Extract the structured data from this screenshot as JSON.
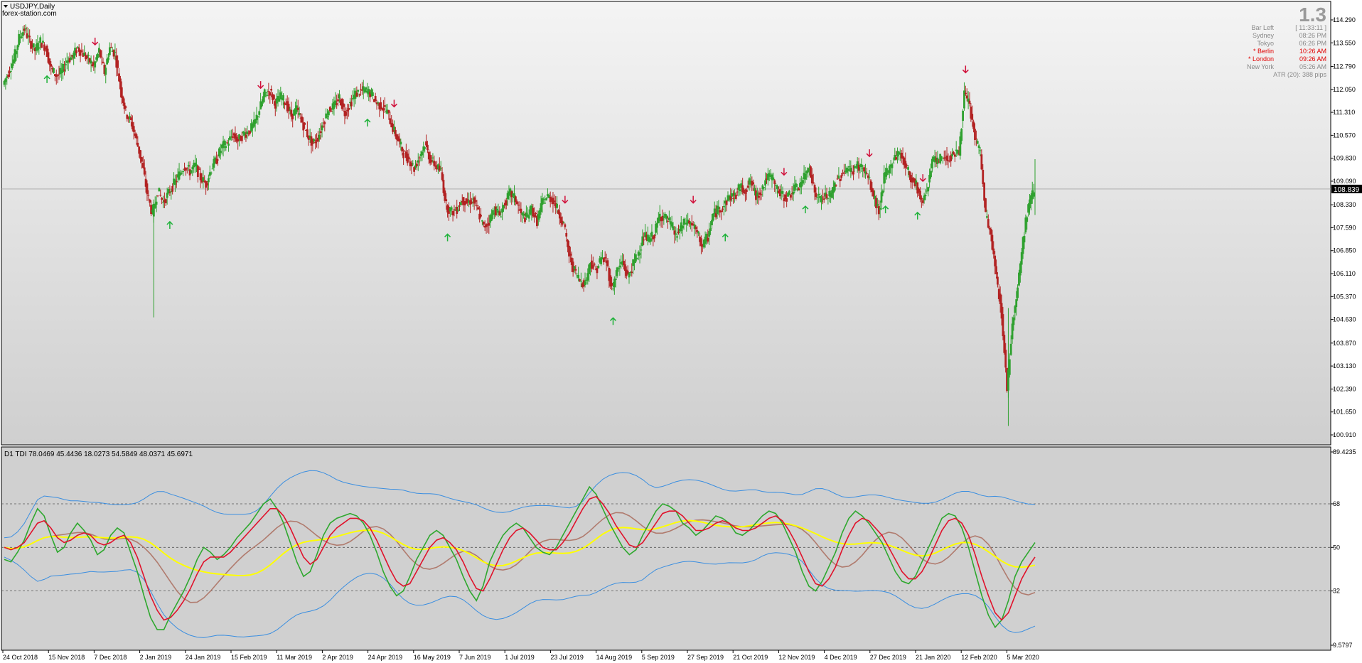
{
  "main_panel": {
    "symbol_label": "USDJPY,Daily",
    "watermark": "forex-station.com",
    "current_price_label": "108.839",
    "current_price": 108.839,
    "y_ticks": [
      "114.290",
      "113.550",
      "112.790",
      "112.050",
      "111.310",
      "110.570",
      "109.830",
      "109.090",
      "108.330",
      "107.590",
      "106.850",
      "106.110",
      "105.370",
      "104.630",
      "103.870",
      "103.130",
      "102.390",
      "101.650",
      "100.910"
    ],
    "colors": {
      "bull": "#2fa12f",
      "bear": "#b22222",
      "arrow_up": "#1fb23a",
      "arrow_down": "#d0103a",
      "gridline": "#a8a8a8"
    }
  },
  "info_panel": {
    "big_value": "1.3",
    "rows": [
      {
        "label": "Bar Left",
        "value": "[ 11:33:11 ]",
        "highlight": false
      },
      {
        "label": "Sydney",
        "value": "08:26 PM",
        "highlight": false
      },
      {
        "label": "Tokyo",
        "value": "06:26 PM",
        "highlight": false
      },
      {
        "label": "* Berlin",
        "value": "10:26 AM",
        "highlight": true
      },
      {
        "label": "* London",
        "value": "09:26 AM",
        "highlight": true
      },
      {
        "label": "New York",
        "value": "05:26 AM",
        "highlight": false
      },
      {
        "label": "ATR (20): 388 pips",
        "value": "",
        "highlight": false
      }
    ]
  },
  "indicator_panel": {
    "label": "D1 TDI 78.0469 45.4436 18.0273 54.5849 48.0371 45.6971",
    "y_ticks": [
      "89.4235",
      "68",
      "50",
      "32",
      "9.5797"
    ],
    "colors": {
      "upper_band": "#3a8ee0",
      "green": "#2ea82e",
      "red": "#e0122b",
      "yellow": "#ffff00",
      "brown": "#b07b6e"
    }
  },
  "x_axis": {
    "labels": [
      "24 Oct 2018",
      "15 Nov 2018",
      "7 Dec 2018",
      "2 Jan 2019",
      "24 Jan 2019",
      "15 Feb 2019",
      "11 Mar 2019",
      "2 Apr 2019",
      "24 Apr 2019",
      "16 May 2019",
      "7 Jun 2019",
      "1 Jul 2019",
      "23 Jul 2019",
      "14 Aug 2019",
      "5 Sep 2019",
      "27 Sep 2019",
      "21 Oct 2019",
      "12 Nov 2019",
      "4 Dec 2019",
      "27 Dec 2019",
      "21 Jan 2020",
      "12 Feb 2020",
      "5 Mar 2020"
    ]
  },
  "chart_data": [
    {
      "type": "candlestick",
      "title": "USDJPY,Daily",
      "ylim": [
        100.91,
        114.29
      ],
      "price_path": [
        [
          0,
          112.2
        ],
        [
          1,
          112.6
        ],
        [
          2,
          113.0
        ],
        [
          3,
          113.7
        ],
        [
          4,
          114.0
        ],
        [
          5,
          113.6
        ],
        [
          6,
          113.3
        ],
        [
          7,
          113.6
        ],
        [
          8,
          113.4
        ],
        [
          9,
          112.7
        ],
        [
          10,
          112.5
        ],
        [
          11,
          112.6
        ],
        [
          12,
          113.0
        ],
        [
          13,
          113.1
        ],
        [
          14,
          113.4
        ],
        [
          15,
          113.2
        ],
        [
          16,
          113.0
        ],
        [
          17,
          112.8
        ],
        [
          18,
          113.3
        ],
        [
          19,
          112.6
        ],
        [
          20,
          113.4
        ],
        [
          21,
          113.2
        ],
        [
          22,
          112.1
        ],
        [
          23,
          111.3
        ],
        [
          24,
          111.0
        ],
        [
          25,
          110.4
        ],
        [
          26,
          109.7
        ],
        [
          27,
          108.7
        ],
        [
          28,
          108.0
        ],
        [
          29,
          108.8
        ],
        [
          30,
          108.4
        ],
        [
          31,
          108.7
        ],
        [
          32,
          109.0
        ],
        [
          33,
          109.3
        ],
        [
          34,
          109.6
        ],
        [
          35,
          109.4
        ],
        [
          36,
          109.6
        ],
        [
          37,
          109.2
        ],
        [
          38,
          109.0
        ],
        [
          39,
          109.5
        ],
        [
          40,
          109.8
        ],
        [
          41,
          110.2
        ],
        [
          42,
          110.3
        ],
        [
          43,
          110.6
        ],
        [
          44,
          110.4
        ],
        [
          45,
          110.6
        ],
        [
          46,
          110.7
        ],
        [
          47,
          110.9
        ],
        [
          48,
          111.4
        ],
        [
          49,
          111.9
        ],
        [
          50,
          112.0
        ],
        [
          51,
          111.6
        ],
        [
          52,
          111.8
        ],
        [
          53,
          111.6
        ],
        [
          54,
          111.2
        ],
        [
          55,
          111.4
        ],
        [
          56,
          111.0
        ],
        [
          57,
          110.6
        ],
        [
          58,
          110.3
        ],
        [
          59,
          110.5
        ],
        [
          60,
          111.0
        ],
        [
          61,
          111.4
        ],
        [
          62,
          111.5
        ],
        [
          63,
          111.8
        ],
        [
          64,
          111.3
        ],
        [
          65,
          111.6
        ],
        [
          66,
          111.9
        ],
        [
          67,
          112.0
        ],
        [
          68,
          112.0
        ],
        [
          69,
          111.9
        ],
        [
          70,
          111.6
        ],
        [
          71,
          111.5
        ],
        [
          72,
          111.3
        ],
        [
          73,
          110.8
        ],
        [
          74,
          110.4
        ],
        [
          75,
          110.0
        ],
        [
          76,
          109.8
        ],
        [
          77,
          109.5
        ],
        [
          78,
          109.9
        ],
        [
          79,
          110.3
        ],
        [
          80,
          109.8
        ],
        [
          81,
          109.6
        ],
        [
          82,
          109.4
        ],
        [
          83,
          108.3
        ],
        [
          84,
          108.1
        ],
        [
          85,
          108.2
        ],
        [
          86,
          108.5
        ],
        [
          87,
          108.4
        ],
        [
          88,
          108.5
        ],
        [
          89,
          108.1
        ],
        [
          90,
          107.6
        ],
        [
          91,
          107.8
        ],
        [
          92,
          108.2
        ],
        [
          93,
          108.0
        ],
        [
          94,
          108.4
        ],
        [
          95,
          108.7
        ],
        [
          96,
          108.5
        ],
        [
          97,
          108.0
        ],
        [
          98,
          107.9
        ],
        [
          99,
          108.2
        ],
        [
          100,
          107.8
        ],
        [
          101,
          108.4
        ],
        [
          102,
          108.6
        ],
        [
          103,
          108.5
        ],
        [
          104,
          108.1
        ],
        [
          105,
          107.7
        ],
        [
          106,
          106.7
        ],
        [
          107,
          106.2
        ],
        [
          108,
          105.9
        ],
        [
          109,
          105.8
        ],
        [
          110,
          106.5
        ],
        [
          111,
          106.2
        ],
        [
          112,
          106.6
        ],
        [
          113,
          106.5
        ],
        [
          114,
          105.6
        ],
        [
          115,
          106.2
        ],
        [
          116,
          106.5
        ],
        [
          117,
          106.0
        ],
        [
          118,
          106.4
        ],
        [
          119,
          106.8
        ],
        [
          120,
          107.3
        ],
        [
          121,
          107.2
        ],
        [
          122,
          107.4
        ],
        [
          123,
          108.0
        ],
        [
          124,
          107.9
        ],
        [
          125,
          107.7
        ],
        [
          126,
          107.3
        ],
        [
          127,
          107.6
        ],
        [
          128,
          107.8
        ],
        [
          129,
          107.7
        ],
        [
          130,
          107.4
        ],
        [
          131,
          107.0
        ],
        [
          132,
          107.3
        ],
        [
          133,
          108.0
        ],
        [
          134,
          108.2
        ],
        [
          135,
          108.3
        ],
        [
          136,
          108.6
        ],
        [
          137,
          108.6
        ],
        [
          138,
          108.9
        ],
        [
          139,
          108.8
        ],
        [
          140,
          109.1
        ],
        [
          141,
          108.6
        ],
        [
          142,
          108.8
        ],
        [
          143,
          109.2
        ],
        [
          144,
          109.2
        ],
        [
          145,
          108.8
        ],
        [
          146,
          108.6
        ],
        [
          147,
          108.6
        ],
        [
          148,
          108.8
        ],
        [
          149,
          108.9
        ],
        [
          150,
          109.2
        ],
        [
          151,
          109.6
        ],
        [
          152,
          108.7
        ],
        [
          153,
          108.5
        ],
        [
          154,
          108.6
        ],
        [
          155,
          108.6
        ],
        [
          156,
          109.1
        ],
        [
          157,
          109.3
        ],
        [
          158,
          109.5
        ],
        [
          159,
          109.4
        ],
        [
          160,
          109.6
        ],
        [
          161,
          109.5
        ],
        [
          162,
          109.2
        ],
        [
          163,
          108.6
        ],
        [
          164,
          108.1
        ],
        [
          165,
          109.2
        ],
        [
          166,
          109.5
        ],
        [
          167,
          109.9
        ],
        [
          168,
          110.0
        ],
        [
          169,
          109.6
        ],
        [
          170,
          109.2
        ],
        [
          171,
          109.0
        ],
        [
          172,
          108.4
        ],
        [
          173,
          108.8
        ],
        [
          174,
          109.8
        ],
        [
          175,
          109.7
        ],
        [
          176,
          109.9
        ],
        [
          177,
          109.8
        ],
        [
          178,
          110.0
        ],
        [
          179,
          110.0
        ],
        [
          180,
          111.9
        ],
        [
          181,
          111.5
        ],
        [
          182,
          110.5
        ],
        [
          183,
          110.0
        ],
        [
          184,
          108.0
        ],
        [
          185,
          107.3
        ],
        [
          186,
          106.0
        ],
        [
          187,
          104.8
        ],
        [
          188,
          102.4
        ],
        [
          189,
          104.5
        ],
        [
          190,
          105.7
        ],
        [
          191,
          107.2
        ],
        [
          192,
          108.3
        ],
        [
          193,
          108.8
        ]
      ],
      "range": {
        "low": 101.2,
        "high": 114.2
      },
      "signals": {
        "up": [
          8,
          31,
          68,
          83,
          114,
          135,
          150,
          165,
          171
        ],
        "down": [
          17,
          48,
          73,
          105,
          129,
          146,
          162,
          172,
          180
        ]
      }
    },
    {
      "type": "line",
      "title": "D1 TDI 78.0469 45.4436 18.0273 54.5849 48.0371 45.6971",
      "ylim": [
        9.5797,
        89.4235
      ],
      "levels": [
        68,
        50,
        32
      ],
      "series": [
        {
          "values": [
            45,
            44,
            48,
            53,
            60,
            66,
            63,
            55,
            48,
            50,
            56,
            60,
            57,
            53,
            47,
            49,
            55,
            58,
            56,
            48,
            40,
            30,
            21,
            16,
            16,
            22,
            27,
            32,
            38,
            45,
            50,
            48,
            45,
            47,
            50,
            54,
            57,
            60,
            64,
            68,
            70,
            66,
            60,
            52,
            44,
            38,
            40,
            47,
            55,
            60,
            62,
            63,
            64,
            63,
            60,
            55,
            48,
            40,
            34,
            30,
            32,
            38,
            45,
            50,
            55,
            57,
            55,
            50,
            45,
            38,
            32,
            28,
            34,
            44,
            50,
            55,
            58,
            60,
            58,
            54,
            50,
            48,
            47,
            50,
            55,
            60,
            65,
            70,
            75,
            72,
            66,
            60,
            55,
            50,
            47,
            49,
            55,
            60,
            65,
            68,
            67,
            65,
            60,
            58,
            55,
            57,
            60,
            63,
            62,
            60,
            56,
            55,
            57,
            60,
            63,
            65,
            64,
            60,
            54,
            48,
            40,
            34,
            32,
            36,
            42,
            48,
            56,
            62,
            65,
            63,
            60,
            56,
            52,
            46,
            40,
            36,
            35,
            38,
            44,
            50,
            56,
            62,
            64,
            63,
            58,
            50,
            40,
            30,
            22,
            17,
            20,
            28,
            38,
            44,
            48,
            52
          ],
          "line_overlay": "green"
        },
        {
          "values": [
            50,
            49,
            50,
            52,
            56,
            60,
            61,
            58,
            54,
            52,
            53,
            55,
            56,
            55,
            52,
            51,
            52,
            54,
            55,
            52,
            46,
            38,
            30,
            24,
            20,
            21,
            24,
            28,
            33,
            39,
            44,
            46,
            46,
            46,
            48,
            51,
            54,
            57,
            60,
            63,
            66,
            66,
            63,
            58,
            52,
            46,
            43,
            45,
            50,
            55,
            58,
            60,
            62,
            62,
            61,
            58,
            53,
            47,
            41,
            36,
            34,
            35,
            40,
            45,
            50,
            53,
            54,
            52,
            49,
            44,
            38,
            33,
            32,
            37,
            43,
            49,
            54,
            57,
            58,
            56,
            53,
            50,
            49,
            49,
            52,
            56,
            61,
            66,
            70,
            71,
            68,
            64,
            59,
            55,
            51,
            50,
            52,
            56,
            60,
            64,
            65,
            65,
            63,
            60,
            57,
            57,
            58,
            60,
            61,
            60,
            58,
            57,
            57,
            58,
            60,
            62,
            63,
            61,
            57,
            52,
            46,
            40,
            35,
            34,
            37,
            42,
            49,
            55,
            60,
            62,
            61,
            58,
            55,
            50,
            45,
            40,
            37,
            37,
            40,
            45,
            51,
            57,
            61,
            62,
            60,
            55,
            47,
            38,
            30,
            23,
            20,
            23,
            30,
            37,
            42,
            46
          ],
          "line_overlay": "red"
        }
      ]
    }
  ]
}
